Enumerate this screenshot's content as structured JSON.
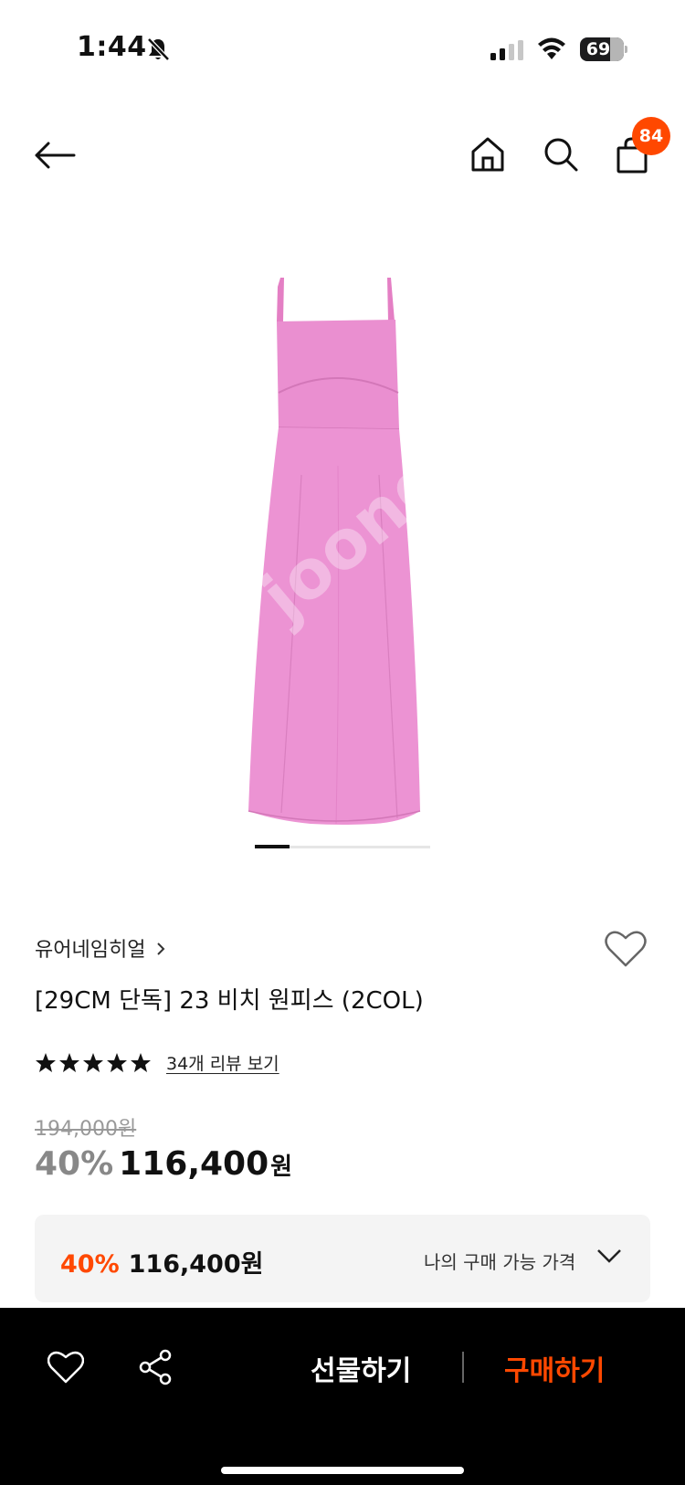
{
  "status_bar": {
    "time": "1:44",
    "battery": "69",
    "icons": [
      "bell-slash-icon",
      "cellular-signal-icon",
      "wifi-icon",
      "battery-icon"
    ]
  },
  "header": {
    "cart_count": "84",
    "icons": [
      "back-arrow-icon",
      "home-icon",
      "search-icon",
      "shopping-bag-icon"
    ]
  },
  "gallery": {
    "current_index": 1,
    "watermark": "joonggonara.com/joon"
  },
  "product": {
    "brand": "유어네임히얼",
    "title": "[29CM 단독] 23 비치 원피스 (2COL)",
    "rating": 5,
    "review_link": "34개 리뷰 보기",
    "original_price": "194,000원",
    "discount_rate": "40%",
    "sale_price": "116,400",
    "currency": "원"
  },
  "my_price": {
    "discount_rate": "40%",
    "price": "116,400원",
    "label": "나의 구매 가능 가격"
  },
  "bottom_bar": {
    "gift_label": "선물하기",
    "buy_label": "구매하기"
  },
  "colors": {
    "accent": "#ff4800",
    "dress": "#e98fcf",
    "bottom_bar": "#000000"
  }
}
